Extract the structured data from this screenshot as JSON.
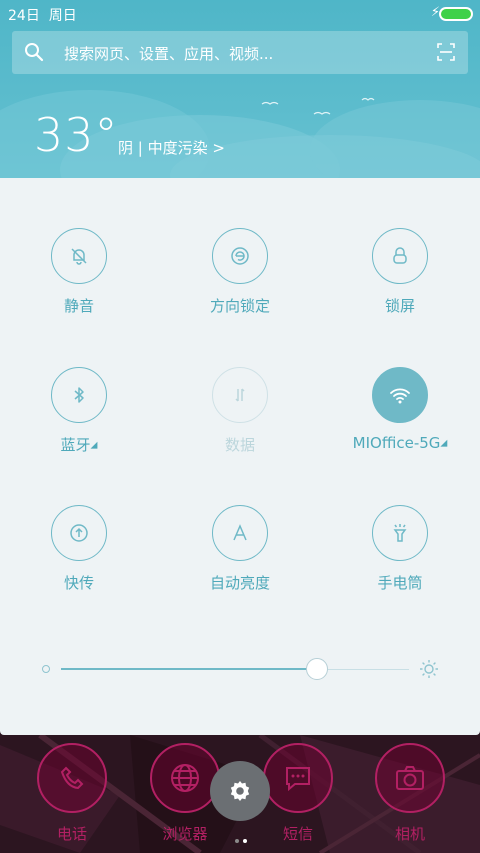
{
  "status_bar": {
    "date": "24日",
    "weekday": "周日",
    "battery_level": 1.0
  },
  "search": {
    "placeholder": "搜索网页、设置、应用、视频..."
  },
  "weather": {
    "temperature": "33°",
    "condition": "阴 | 中度污染 >"
  },
  "toggles": [
    {
      "label": "静音",
      "icon": "bell-muted-icon",
      "state": "off"
    },
    {
      "label": "方向锁定",
      "icon": "rotation-lock-icon",
      "state": "off"
    },
    {
      "label": "锁屏",
      "icon": "lock-icon",
      "state": "off"
    },
    {
      "label": "蓝牙",
      "icon": "bluetooth-icon",
      "state": "off",
      "has_submenu": true
    },
    {
      "label": "数据",
      "icon": "mobile-data-icon",
      "state": "disabled"
    },
    {
      "label": "MIOffice-5G",
      "icon": "wifi-icon",
      "state": "on",
      "has_submenu": true
    },
    {
      "label": "快传",
      "icon": "transfer-icon",
      "state": "off"
    },
    {
      "label": "自动亮度",
      "icon": "auto-brightness-icon",
      "state": "off"
    },
    {
      "label": "手电筒",
      "icon": "flashlight-icon",
      "state": "off"
    }
  ],
  "brightness": {
    "level": 0.735
  },
  "dock": {
    "apps": [
      {
        "label": "电话",
        "icon": "phone-icon"
      },
      {
        "label": "浏览器",
        "icon": "globe-icon"
      },
      {
        "label": "短信",
        "icon": "message-icon"
      },
      {
        "label": "相机",
        "icon": "camera-icon"
      }
    ],
    "settings_icon": "gear-icon",
    "page_count": 2,
    "current_page": 2
  },
  "colors": {
    "accent": "#6fb9c7",
    "header_bg": "#5cbccd",
    "panel_bg": "#eef3f5",
    "battery": "#3fd14a",
    "dock_app": "#b22063"
  }
}
